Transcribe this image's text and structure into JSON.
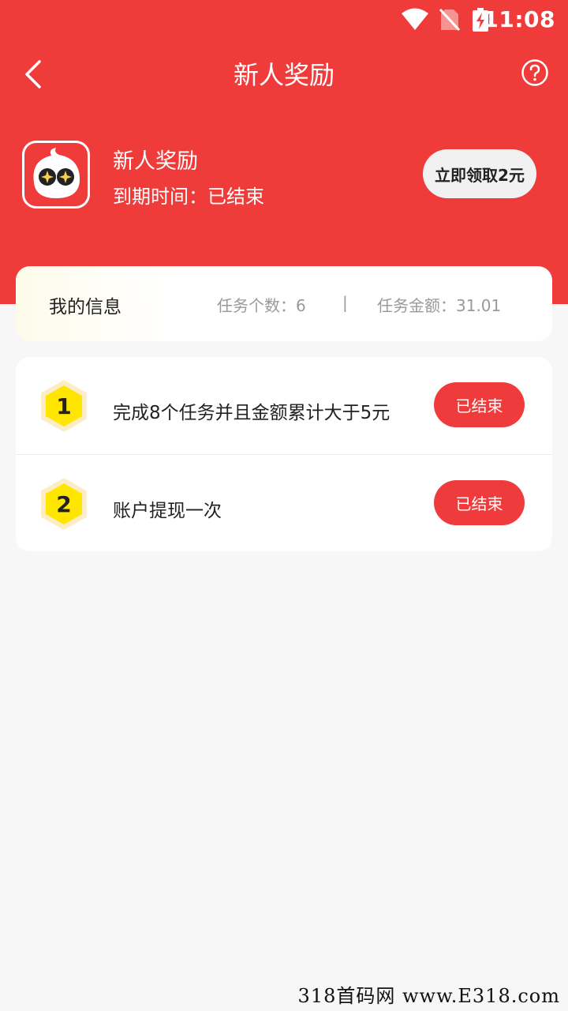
{
  "status_bar": {
    "time": "11:08"
  },
  "app_bar": {
    "title": "新人奖励"
  },
  "reward": {
    "name": "新人奖励",
    "expire_label": "到期时间：",
    "expire_value": "已结束",
    "claim_label": "立即领取2元"
  },
  "info": {
    "title": "我的信息",
    "task_count_label": "任务个数：",
    "task_count_value": "6",
    "divider": "|",
    "task_amount_label": "任务金额：",
    "task_amount_value": "31.01"
  },
  "tasks": [
    {
      "number": "1",
      "text": "完成8个任务并且金额累计大于5元",
      "status": "已结束"
    },
    {
      "number": "2",
      "text": "账户提现一次",
      "status": "已结束"
    }
  ],
  "watermark": "318首码网 www.E318.com",
  "colors": {
    "primary": "#f03b3b",
    "badge_fill": "#ffe600",
    "badge_rim": "#fcedc6"
  }
}
